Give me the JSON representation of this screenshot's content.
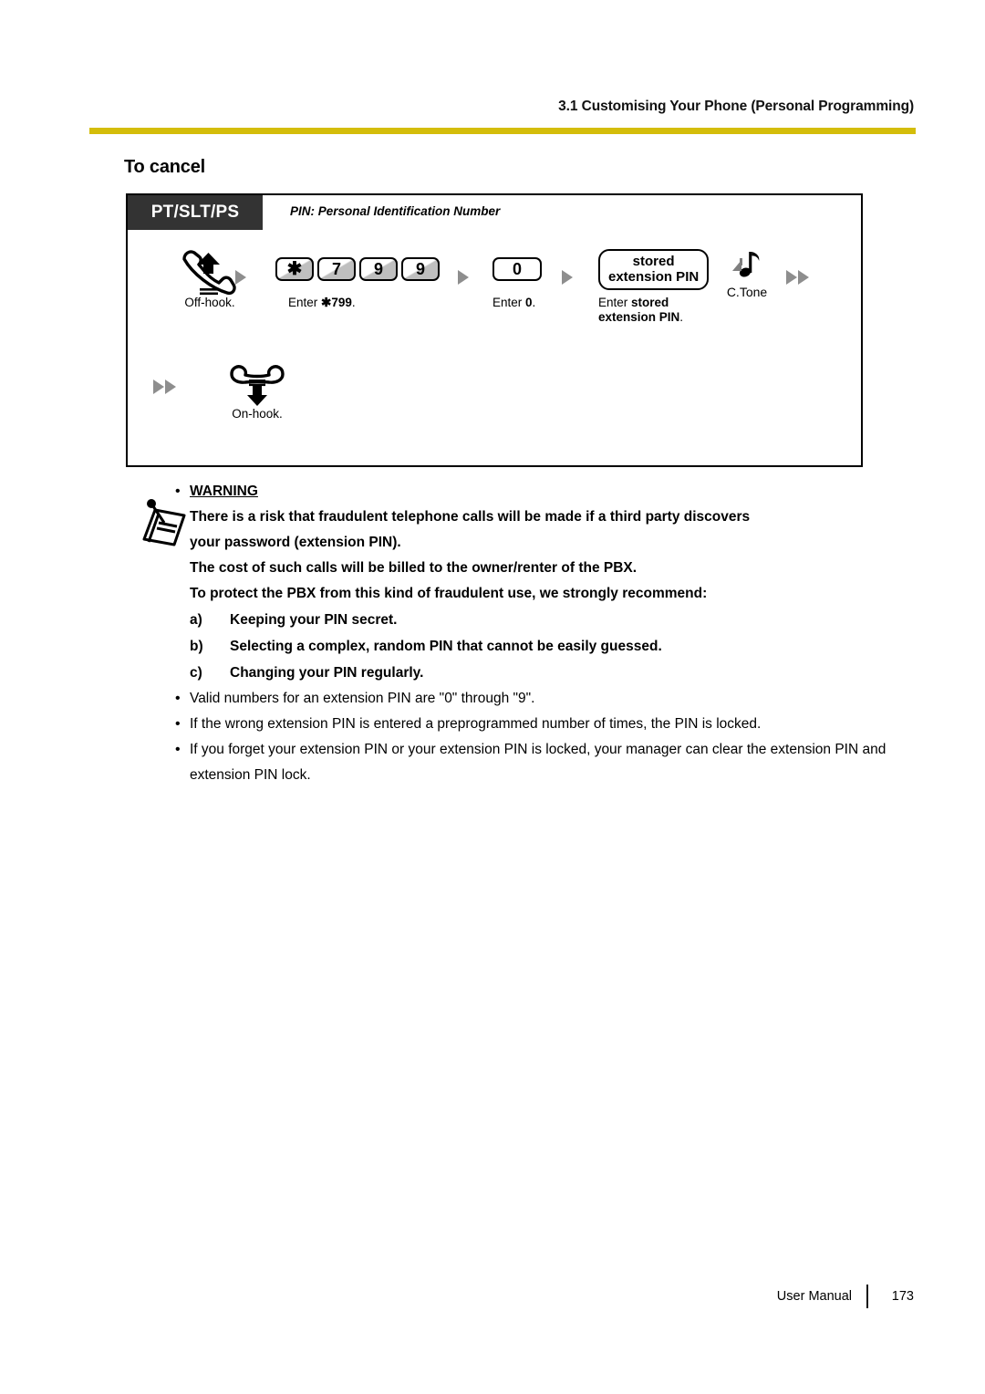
{
  "header": {
    "running_head": "3.1 Customising Your Phone (Personal Programming)",
    "rule_color": "#d4bd0a"
  },
  "section": {
    "title": "To cancel"
  },
  "procedure": {
    "phone_type": "PT/SLT/PS",
    "pin_note": "PIN: Personal Identification Number",
    "steps": [
      {
        "id": "off-hook",
        "icon": "handset-off-hook-icon",
        "caption": "Off-hook."
      },
      {
        "id": "enter-799",
        "keys": [
          "✱",
          "7",
          "9",
          "9"
        ],
        "caption_prefix": "Enter ",
        "caption_bold": "✱799",
        "caption_suffix": "."
      },
      {
        "id": "enter-0",
        "keys": [
          "0"
        ],
        "caption_prefix": "Enter ",
        "caption_bold": "0",
        "caption_suffix": "."
      },
      {
        "id": "enter-stored-extension-pin",
        "box_line1": "stored",
        "box_line2": "extension PIN",
        "caption_prefix": "Enter ",
        "caption_bold": "stored extension PIN",
        "caption_suffix": "."
      },
      {
        "id": "confirmation-tone",
        "icon": "music-note-icon",
        "label": "C.Tone"
      },
      {
        "id": "on-hook",
        "icon": "handset-on-hook-icon",
        "caption": "On-hook."
      }
    ]
  },
  "notes": {
    "warning_label": "WARNING",
    "warning_lines": [
      "There is a risk that fraudulent telephone calls will be made if a third party discovers",
      "your password (extension PIN).",
      "The cost of such calls will be billed to the owner/renter of the PBX.",
      "To protect the PBX from this kind of fraudulent use, we strongly recommend:"
    ],
    "recommendations": [
      {
        "marker": "a)",
        "text": "Keeping your PIN secret."
      },
      {
        "marker": "b)",
        "text": "Selecting a complex, random PIN that cannot be easily guessed."
      },
      {
        "marker": "c)",
        "text": "Changing your PIN regularly."
      }
    ],
    "bullets": [
      "Valid numbers for an extension PIN are \"0\" through \"9\".",
      "If the wrong extension PIN is entered a preprogrammed number of times, the PIN is locked.",
      "If you forget your extension PIN or your extension PIN is locked, your manager can clear the extension PIN and extension PIN lock."
    ],
    "bullet_marker": "•"
  },
  "footer": {
    "doc_label": "User Manual",
    "page_number": "173"
  }
}
